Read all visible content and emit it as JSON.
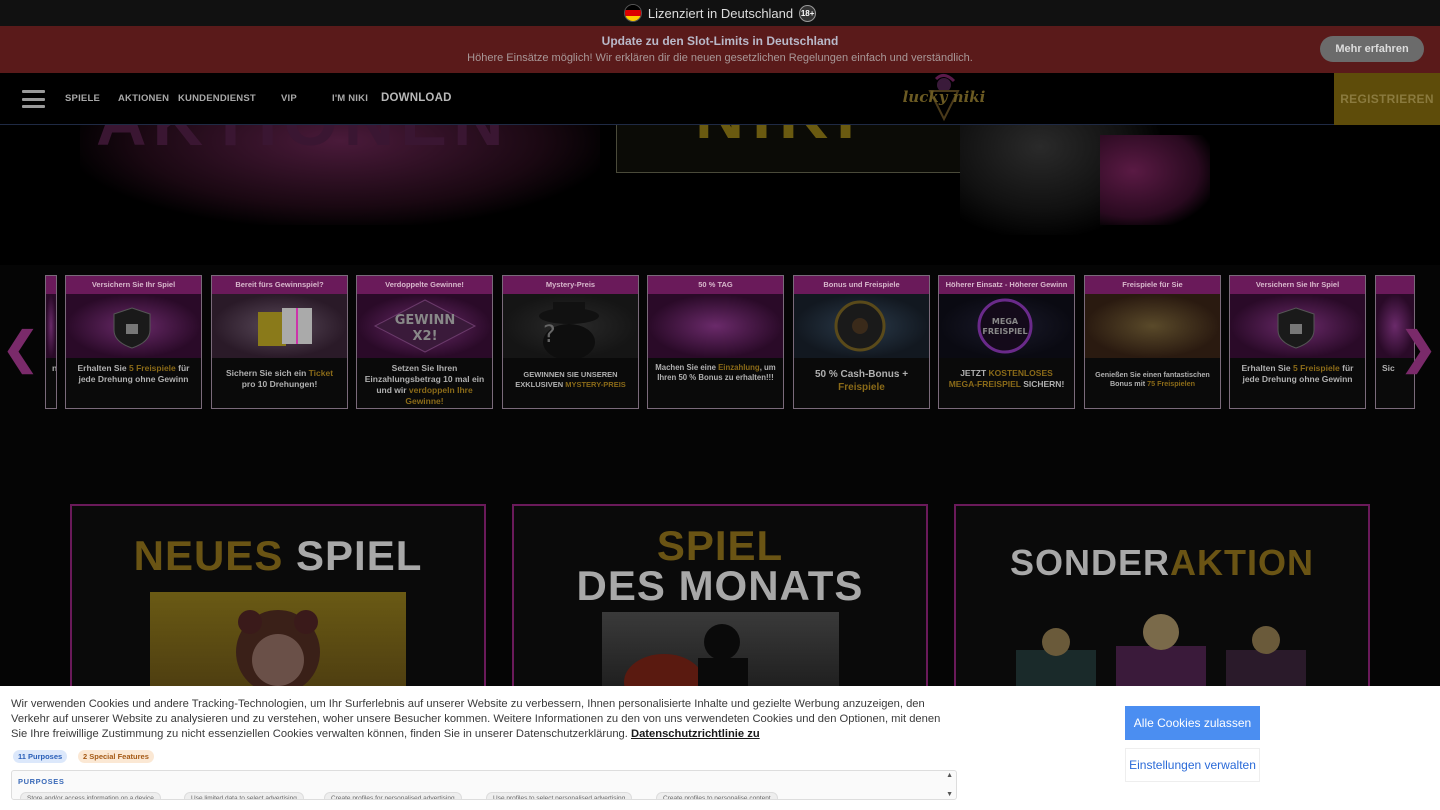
{
  "license": {
    "text": "Lizenziert in Deutschland",
    "age": "18+"
  },
  "update": {
    "title": "Update zu den Slot-Limits in Deutschland",
    "subtitle": "Höhere Einsätze möglich! Wir erklären dir die neuen gesetzlichen Regelungen einfach und verständlich.",
    "button": "Mehr erfahren"
  },
  "nav": {
    "items": [
      "SPIELE",
      "AKTIONEN",
      "KUNDENDIENST",
      "VIP",
      "I'M NIKI",
      "DOWNLOAD"
    ],
    "logo": "lucky niki",
    "register": "REGISTRIEREN"
  },
  "hero": {
    "word_left": "AKTIONEN",
    "word_right": "NIKI"
  },
  "promos": [
    {
      "head": "Versichern Sie Ihr Spiel",
      "text": "Erhalten Sie ",
      "hl": "5 Freispiele",
      "text2": " für jede Drehung ohne Gewinn"
    },
    {
      "head": "Bereit fürs Gewinnspiel?",
      "text": "Sichern Sie sich ein ",
      "hl": "Ticket",
      "text2": " pro 10 Drehungen!"
    },
    {
      "head": "Verdoppelte Gewinne!",
      "text": "Setzen Sie Ihren Einzahlungsbetrag 10 mal ein und wir ",
      "hl": "verdoppeln Ihre Gewinne!",
      "text2": ""
    },
    {
      "head": "Mystery-Preis",
      "text": "GEWINNEN SIE UNSEREN EXKLUSIVEN ",
      "hl": "MYSTERY-PREIS",
      "text2": ""
    },
    {
      "head": "50 % TAG",
      "text": "Machen Sie eine ",
      "hl": "Einzahlung",
      "text2": ", um Ihren 50 % Bonus zu erhalten!!!"
    },
    {
      "head": "Bonus und Freispiele",
      "text": "50 % Cash-Bonus + ",
      "hl": "Freispiele",
      "text2": ""
    },
    {
      "head": "Höherer Einsatz - Höherer Gewinn",
      "text": "JETZT ",
      "hl": "KOSTENLOSES MEGA-FREISPIEL",
      "text2": " SICHERN!"
    },
    {
      "head": "Freispiele für Sie",
      "text": "Genießen Sie einen fantastischen Bonus mit ",
      "hl": "75 Freispielen",
      "text2": ""
    },
    {
      "head": "Versichern Sie Ihr Spiel",
      "text": "Erhalten Sie ",
      "hl": "5 Freispiele",
      "text2": " für jede Drehung ohne Gewinn"
    }
  ],
  "partial_left_text": "n",
  "partial_right_text": "Sic",
  "features": [
    {
      "title_gold": "NEUES",
      "title_grey": " SPIEL"
    },
    {
      "title_gold": "SPIEL",
      "title_grey": "DES MONATS"
    },
    {
      "title_grey": "SONDER",
      "title_gold": "AKTION"
    }
  ],
  "cookie": {
    "text": "Wir verwenden Cookies und andere Tracking-Technologien, um Ihr Surferlebnis auf unserer Website zu verbessern, Ihnen personalisierte Inhalte und gezielte Werbung anzuzeigen, den Verkehr auf unserer Website zu analysieren und zu verstehen, woher unsere Besucher kommen. Weitere Informationen zu den von uns verwendeten Cookies und den Optionen, mit denen Sie Ihre freiwillige Zustimmung zu nicht essenziellen Cookies verwalten können, finden Sie in unserer Datenschutzerklärung.",
    "link": "Datenschutzrichtlinie zu",
    "tag_purposes": "11 Purposes",
    "tag_special": "2 Special Features",
    "purposes_label": "PURPOSES",
    "purpose_pills": [
      "Store and/or access information on a device",
      "Use limited data to select advertising",
      "Create profiles for personalised advertising",
      "Use profiles to select personalised advertising",
      "Create profiles to personalise content"
    ],
    "accept": "Alle Cookies zulassen",
    "manage": "Einstellungen verwalten"
  },
  "colors": {
    "accent_gold": "#6a5414",
    "accent_magenta": "#6a1a5a",
    "cookie_blue": "#4b8ef1"
  }
}
